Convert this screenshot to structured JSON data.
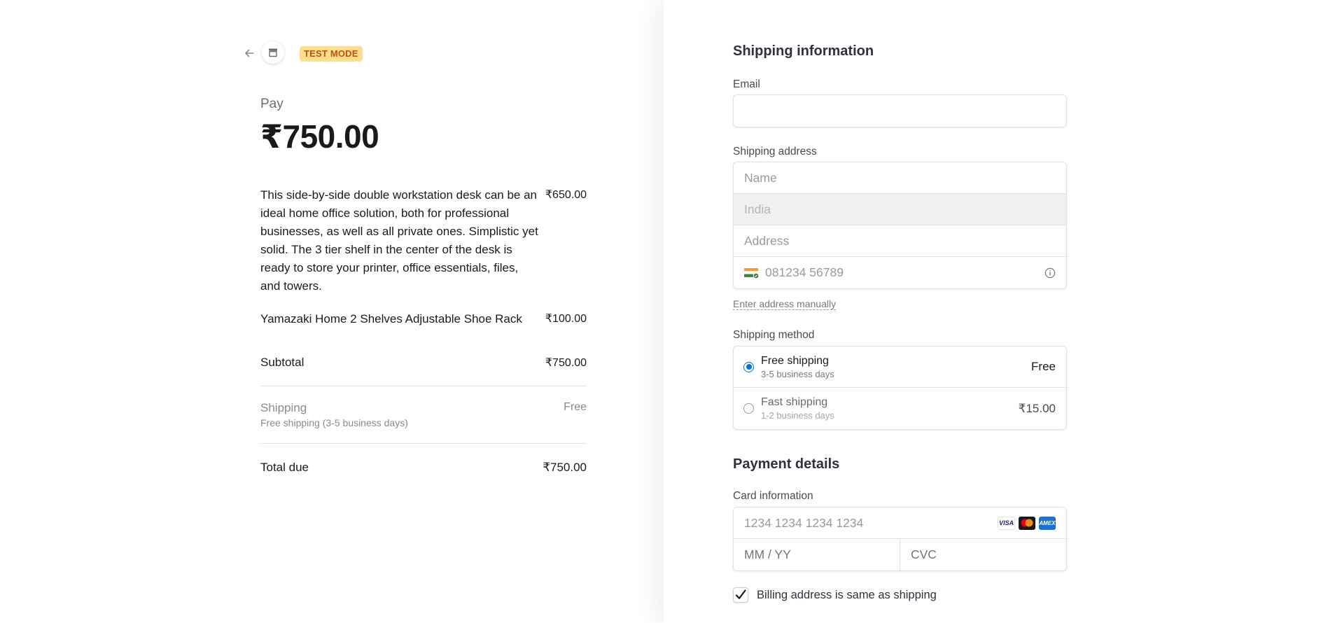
{
  "header": {
    "test_badge": "TEST MODE"
  },
  "summary": {
    "pay_label": "Pay",
    "pay_amount": "₹750.00",
    "items": [
      {
        "description": "This side-by-side double workstation desk can be an ideal home office solution, both for professional businesses, as well as all private ones. Simplistic yet solid. The 3 tier shelf in the center of the desk is ready to store your printer, office essentials, files, and towers.",
        "price": "₹650.00"
      },
      {
        "description": "Yamazaki Home 2 Shelves Adjustable Shoe Rack",
        "price": "₹100.00"
      }
    ],
    "subtotal_label": "Subtotal",
    "subtotal_value": "₹750.00",
    "shipping_label": "Shipping",
    "shipping_detail": "Free shipping (3-5 business days)",
    "shipping_value": "Free",
    "total_label": "Total due",
    "total_value": "₹750.00"
  },
  "shipping_info": {
    "title": "Shipping information",
    "email_label": "Email",
    "email_value": "",
    "address_label": "Shipping address",
    "name_placeholder": "Name",
    "country_value": "India",
    "address_placeholder": "Address",
    "phone_placeholder": "081234 56789",
    "manual_link": "Enter address manually"
  },
  "shipping_method": {
    "label": "Shipping method",
    "options": [
      {
        "name": "Free shipping",
        "detail": "3-5 business days",
        "price": "Free",
        "selected": true
      },
      {
        "name": "Fast shipping",
        "detail": "1-2 business days",
        "price": "₹15.00",
        "selected": false
      }
    ]
  },
  "payment": {
    "title": "Payment details",
    "card_label": "Card information",
    "card_number_placeholder": "1234 1234 1234 1234",
    "expiry_placeholder": "MM / YY",
    "cvc_placeholder": "CVC",
    "brands": [
      "VISA",
      "mastercard",
      "AMEX"
    ],
    "billing_same_label": "Billing address is same as shipping",
    "billing_same_checked": true
  },
  "colors": {
    "accent": "#0570de",
    "badge_bg": "#ffde92",
    "badge_text": "#bb5504"
  }
}
